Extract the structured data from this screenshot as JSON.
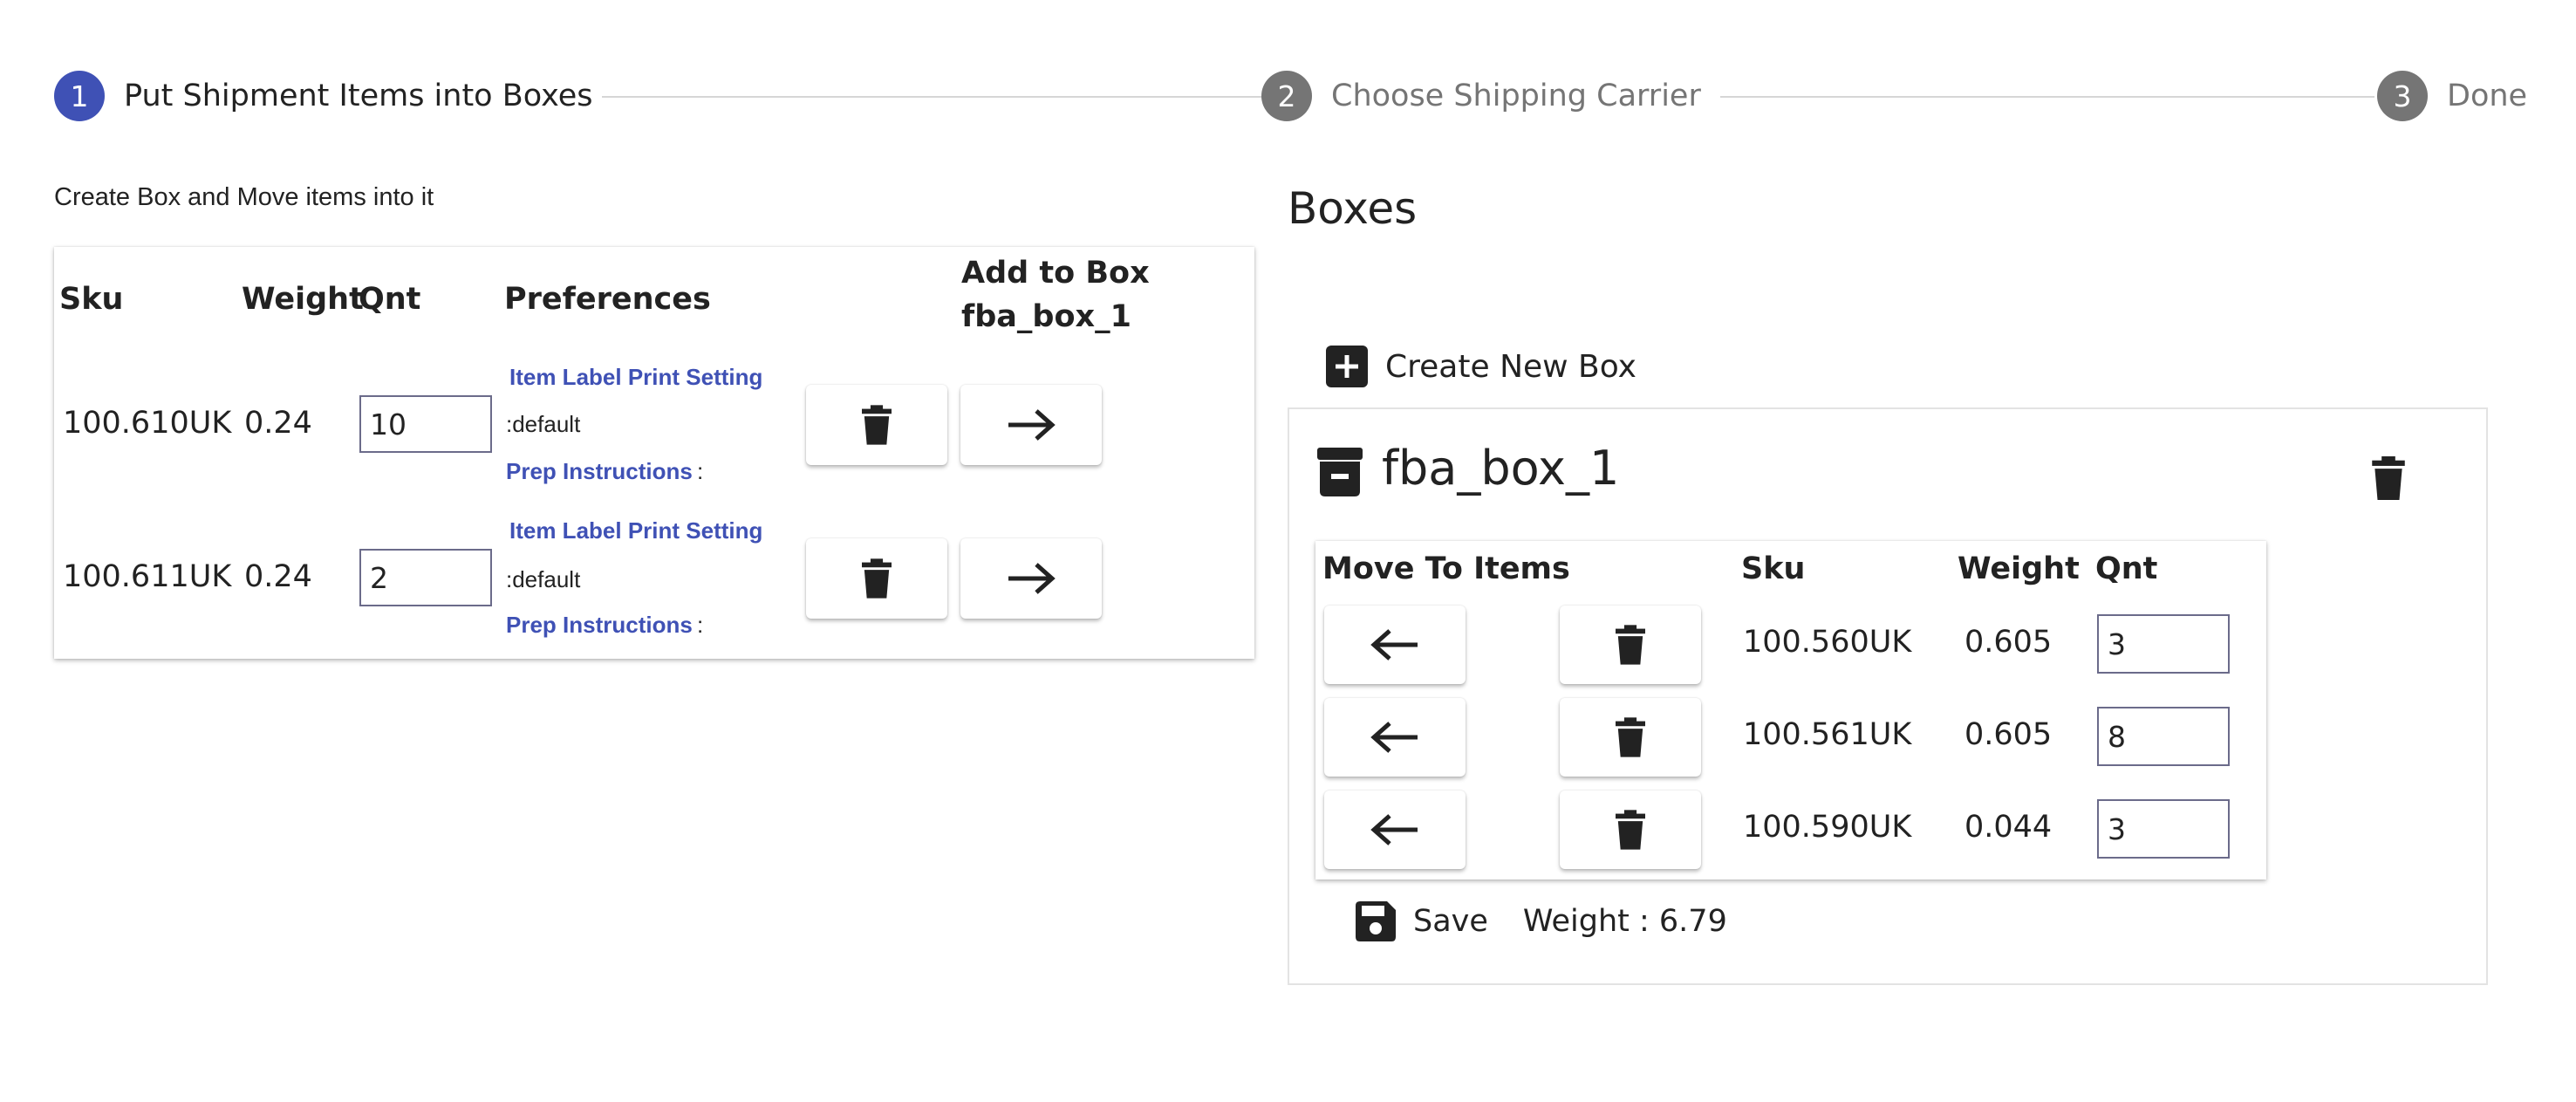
{
  "stepper": {
    "steps": [
      {
        "number": "1",
        "label": "Put Shipment Items into Boxes",
        "active": true
      },
      {
        "number": "2",
        "label": "Choose Shipping Carrier",
        "active": false
      },
      {
        "number": "3",
        "label": "Done",
        "active": false
      }
    ],
    "active_color": "#3f51b5",
    "inactive_color": "#757575"
  },
  "items": {
    "subtitle": "Create Box and Move items into it",
    "headers": {
      "sku": "Sku",
      "weight": "Weight",
      "qnt": "Qnt",
      "preferences": "Preferences",
      "add_to_box_line1": "Add to Box",
      "add_to_box_line2": "fba_box_1"
    },
    "rows": [
      {
        "sku": "100.610UK",
        "weight": "0.24",
        "qnt": "10",
        "label_setting_link": "Item Label Print Setting",
        "label_setting_value": ":default",
        "prep_link": "Prep Instructions",
        "prep_value": ":"
      },
      {
        "sku": "100.611UK",
        "weight": "0.24",
        "qnt": "2",
        "label_setting_link": "Item Label Print Setting",
        "label_setting_value": ":default",
        "prep_link": "Prep Instructions",
        "prep_value": ":"
      }
    ]
  },
  "boxes": {
    "title": "Boxes",
    "create_label": "Create New Box",
    "box": {
      "name": "fba_box_1",
      "headers": {
        "move": "Move To Items",
        "sku": "Sku",
        "weight": "Weight",
        "qnt": "Qnt"
      },
      "rows": [
        {
          "sku": "100.560UK",
          "weight": "0.605",
          "qnt": "3"
        },
        {
          "sku": "100.561UK",
          "weight": "0.605",
          "qnt": "8"
        },
        {
          "sku": "100.590UK",
          "weight": "0.044",
          "qnt": "3"
        }
      ],
      "save_label": "Save",
      "weight_text": "Weight : 6.79"
    }
  },
  "icons": {
    "trash": "trash-icon",
    "arrow_right": "arrow-right-icon",
    "arrow_left": "arrow-left-icon",
    "add_box": "add-box-icon",
    "archive": "archive-box-icon",
    "save": "floppy-disk-icon"
  }
}
